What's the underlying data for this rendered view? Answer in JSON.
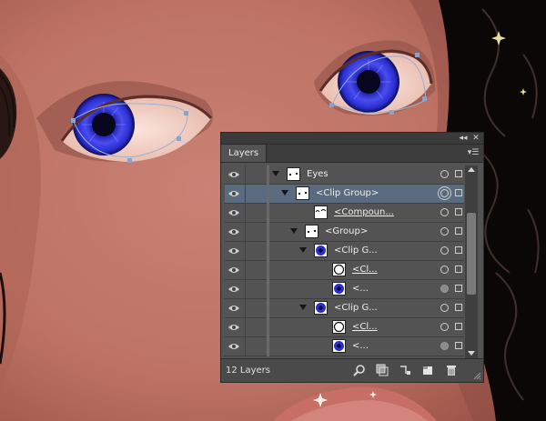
{
  "panel": {
    "tab_label": "Layers",
    "collapse_glyph": "◂◂",
    "close_glyph": "✕",
    "menu_glyph": "▾☰",
    "layer_count_label": "12 Layers"
  },
  "layers": [
    {
      "name": "Eyes",
      "indent": 0,
      "expanded": true,
      "thumb": "dots",
      "underline": false,
      "selected": false,
      "target": "hollow"
    },
    {
      "name": "<Clip Group>",
      "indent": 1,
      "expanded": true,
      "thumb": "dots",
      "underline": false,
      "selected": true,
      "target": "ring"
    },
    {
      "name": "<Compoun...",
      "indent": 3,
      "expanded": null,
      "thumb": "lashes",
      "underline": true,
      "selected": false,
      "target": "hollow"
    },
    {
      "name": "<Group>",
      "indent": 2,
      "expanded": true,
      "thumb": "dots",
      "underline": false,
      "selected": false,
      "target": "hollow"
    },
    {
      "name": "<Clip G...",
      "indent": 3,
      "expanded": true,
      "thumb": "iris",
      "underline": false,
      "selected": false,
      "target": "hollow"
    },
    {
      "name": "<Cl...",
      "indent": 5,
      "expanded": null,
      "thumb": "circle",
      "underline": true,
      "selected": false,
      "target": "hollow"
    },
    {
      "name": "<...",
      "indent": 5,
      "expanded": null,
      "thumb": "iris",
      "underline": false,
      "selected": false,
      "target": "filled"
    },
    {
      "name": "<Clip G...",
      "indent": 3,
      "expanded": true,
      "thumb": "iris",
      "underline": false,
      "selected": false,
      "target": "hollow"
    },
    {
      "name": "<Cl...",
      "indent": 5,
      "expanded": null,
      "thumb": "circle",
      "underline": true,
      "selected": false,
      "target": "hollow"
    },
    {
      "name": "<...",
      "indent": 5,
      "expanded": null,
      "thumb": "iris",
      "underline": false,
      "selected": false,
      "target": "filled"
    }
  ],
  "footer_icons": [
    "locate-object-icon",
    "make-clipping-mask-icon",
    "create-sublayer-icon",
    "new-layer-icon",
    "delete-layer-icon"
  ],
  "colors": {
    "panel_bg": "#535353",
    "selected_row": "#5a6b80",
    "iris_blue": "#2b2fd0",
    "skin": "#c4786a"
  }
}
